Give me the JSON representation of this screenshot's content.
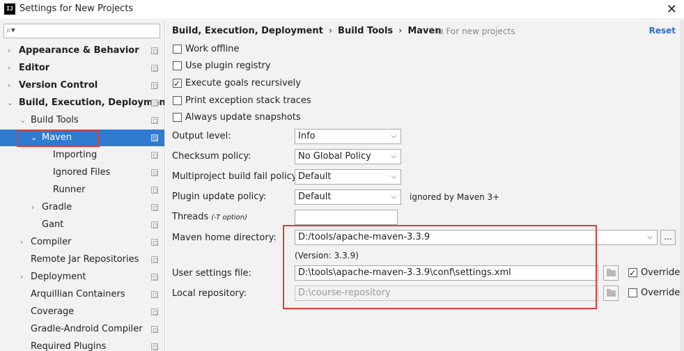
{
  "window": {
    "app_icon_text": "IJ",
    "title": "Settings for New Projects",
    "close_glyph": "✕"
  },
  "search": {
    "placeholder": ""
  },
  "sidebar": {
    "items": [
      {
        "label": "Appearance & Behavior",
        "level": 0,
        "expander": "right",
        "bold": true
      },
      {
        "label": "Editor",
        "level": 0,
        "expander": "right",
        "bold": true
      },
      {
        "label": "Version Control",
        "level": 0,
        "expander": "right",
        "bold": true
      },
      {
        "label": "Build, Execution, Deployment",
        "level": 0,
        "expander": "down",
        "bold": true
      },
      {
        "label": "Build Tools",
        "level": 1,
        "expander": "down",
        "bold": false
      },
      {
        "label": "Maven",
        "level": 2,
        "expander": "down",
        "bold": false,
        "selected": true
      },
      {
        "label": "Importing",
        "level": 3,
        "expander": "none",
        "bold": false
      },
      {
        "label": "Ignored Files",
        "level": 3,
        "expander": "none",
        "bold": false
      },
      {
        "label": "Runner",
        "level": 3,
        "expander": "none",
        "bold": false
      },
      {
        "label": "Gradle",
        "level": 2,
        "expander": "right",
        "bold": false
      },
      {
        "label": "Gant",
        "level": 2,
        "expander": "none",
        "bold": false
      },
      {
        "label": "Compiler",
        "level": 1,
        "expander": "right",
        "bold": false
      },
      {
        "label": "Remote Jar Repositories",
        "level": 1,
        "expander": "none",
        "bold": false
      },
      {
        "label": "Deployment",
        "level": 1,
        "expander": "right",
        "bold": false
      },
      {
        "label": "Arquillian Containers",
        "level": 1,
        "expander": "none",
        "bold": false
      },
      {
        "label": "Coverage",
        "level": 1,
        "expander": "none",
        "bold": false
      },
      {
        "label": "Gradle-Android Compiler",
        "level": 1,
        "expander": "none",
        "bold": false
      },
      {
        "label": "Required Plugins",
        "level": 1,
        "expander": "none",
        "bold": false
      }
    ]
  },
  "breadcrumb": {
    "part1": "Build, Execution, Deployment",
    "part2": "Build Tools",
    "part3": "Maven",
    "separator": "›"
  },
  "for_new_projects": "For new projects",
  "reset": "Reset",
  "checkboxes": [
    {
      "label": "Work offline",
      "checked": false
    },
    {
      "label": "Use plugin registry",
      "checked": false
    },
    {
      "label": "Execute goals recursively",
      "checked": true
    },
    {
      "label": "Print exception stack traces",
      "checked": false
    },
    {
      "label": "Always update snapshots",
      "checked": false
    }
  ],
  "form": {
    "output_level_label": "Output level:",
    "output_level_value": "Info",
    "checksum_label": "Checksum policy:",
    "checksum_value": "No Global Policy",
    "multiproject_label": "Multiproject build fail policy:",
    "multiproject_value": "Default",
    "plugin_update_label": "Plugin update policy:",
    "plugin_update_value": "Default",
    "plugin_update_note": "ignored by Maven 3+",
    "threads_label": "Threads",
    "threads_hint": "(-T option)",
    "threads_value": "",
    "maven_home_label": "Maven home directory:",
    "maven_home_value": "D:/tools/apache-maven-3.3.9",
    "maven_version": "(Version: 3.3.9)",
    "user_settings_label": "User settings file:",
    "user_settings_value": "D:\\tools\\apache-maven-3.3.9\\conf\\settings.xml",
    "user_settings_override_label": "Override",
    "user_settings_override": true,
    "local_repo_label": "Local repository:",
    "local_repo_value": "D:\\course-repository",
    "local_repo_override_label": "Override",
    "local_repo_override": false,
    "browse_dots": "..."
  },
  "colors": {
    "selection": "#2e7bd0",
    "highlight_box": "#e53935",
    "link": "#2e6dc8"
  }
}
